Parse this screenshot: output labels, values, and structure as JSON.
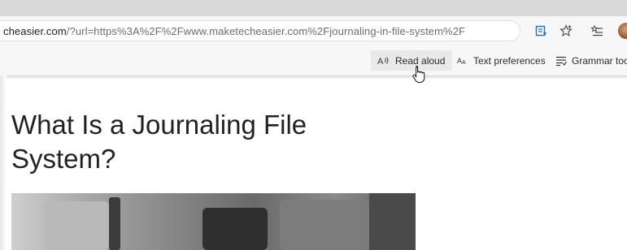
{
  "address_bar": {
    "url_host": "cheasier.com",
    "url_rest": "/?url=https%3A%2F%2Fwww.maketecheasier.com%2Fjournaling-in-file-system%2F"
  },
  "reader_toolbar": {
    "read_aloud_label": "Read aloud",
    "text_preferences_label": "Text preferences",
    "grammar_tools_label": "Grammar too"
  },
  "article": {
    "title": "What Is a Journaling File System?"
  },
  "icons": [
    "immersive-reader-icon",
    "favorite-star-icon",
    "favorites-list-icon",
    "profile-avatar-icon",
    "read-aloud-icon",
    "text-preferences-icon",
    "grammar-tools-icon",
    "hand-cursor-icon"
  ]
}
